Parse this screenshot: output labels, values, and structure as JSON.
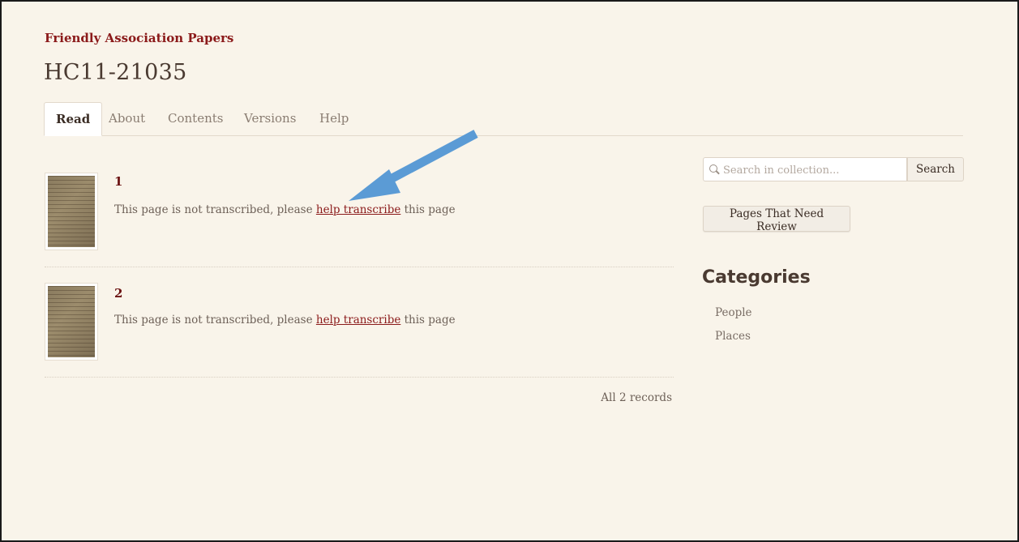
{
  "header": {
    "collection": "Friendly Association Papers",
    "title": "HC11-21035"
  },
  "tabs": [
    {
      "label": "Read",
      "active": true
    },
    {
      "label": "About",
      "active": false
    },
    {
      "label": "Contents",
      "active": false
    },
    {
      "label": "Versions",
      "active": false
    },
    {
      "label": "Help",
      "active": false
    }
  ],
  "records": [
    {
      "number": "1",
      "text_before": "This page is not transcribed, please ",
      "link": "help transcribe",
      "text_after": " this page"
    },
    {
      "number": "2",
      "text_before": "This page is not transcribed, please ",
      "link": "help transcribe",
      "text_after": " this page"
    }
  ],
  "records_count": "All 2 records",
  "sidebar": {
    "search_placeholder": "Search in collection...",
    "search_button": "Search",
    "review_button": "Pages That Need Review",
    "categories_title": "Categories",
    "categories": [
      "People",
      "Places"
    ]
  },
  "colors": {
    "accent": "#8b1a1a",
    "background": "#f9f4ea",
    "annotation_arrow": "#5b9bd5"
  },
  "icons": [
    "search-icon",
    "blue-annotation-arrow-icon"
  ]
}
